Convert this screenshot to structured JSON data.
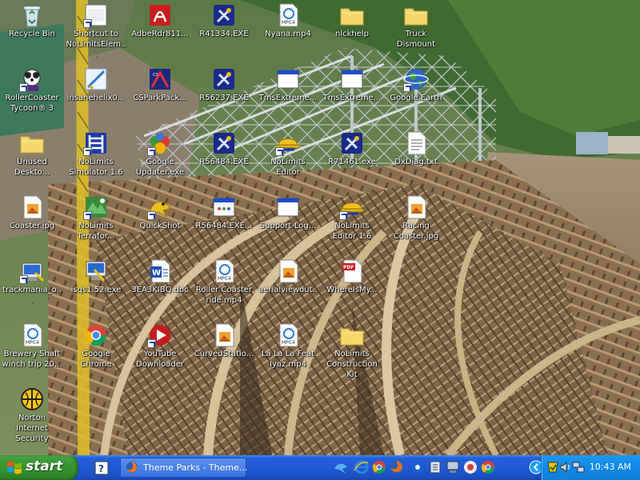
{
  "desktop": {
    "icons": [
      {
        "label": "Recycle Bin",
        "icon": "recycle-bin-icon"
      },
      {
        "label": "Shortcut to NoLimitsElem...",
        "icon": "shortcut-app-icon"
      },
      {
        "label": "AdbeRdr811...",
        "icon": "adobe-reader-installer-icon"
      },
      {
        "label": "R41334.EXE",
        "icon": "installer-exe-icon"
      },
      {
        "label": "Nyana.mp4",
        "icon": "mp4-file-icon"
      },
      {
        "label": "nlckhelp",
        "icon": "folder-icon"
      },
      {
        "label": "Truck Dismount",
        "icon": "folder-icon"
      },
      {
        "label": "RollerCoaster Tycoon® 3",
        "icon": "rollercoaster-tycoon-icon"
      },
      {
        "label": "insanehelix0...",
        "icon": "image-file-icon"
      },
      {
        "label": "CSParkPack...",
        "icon": "csparkpack-icon"
      },
      {
        "label": "R56237.EXE",
        "icon": "installer-exe-icon"
      },
      {
        "label": "TmsExtreme...",
        "icon": "window-app-icon"
      },
      {
        "label": "TmsExtreme...",
        "icon": "window-app-icon"
      },
      {
        "label": "Google Earth",
        "icon": "google-earth-icon"
      },
      {
        "label": "Unused Deskto...",
        "icon": "folder-icon"
      },
      {
        "label": "NoLimits Simulator 1.6",
        "icon": "nolimits-simulator-icon"
      },
      {
        "label": "Google Updater.exe",
        "icon": "google-updater-icon"
      },
      {
        "label": "R56484.EXE",
        "icon": "installer-exe-icon"
      },
      {
        "label": "NoLimits Editor",
        "icon": "nolimits-editor-icon"
      },
      {
        "label": "R71461.exe",
        "icon": "installer-exe-icon"
      },
      {
        "label": "DxDiag.txt",
        "icon": "text-file-icon"
      },
      {
        "label": "Coaster.jpg",
        "icon": "jpg-file-icon"
      },
      {
        "label": "NoLimits Terrafor...",
        "icon": "nolimits-terraformer-icon"
      },
      {
        "label": "QuickShot",
        "icon": "quickshot-icon"
      },
      {
        "label": "R56484.EXE...",
        "icon": "exe-window-icon"
      },
      {
        "label": "Support-Log...",
        "icon": "window-app-icon"
      },
      {
        "label": "NoLimits Editor 1.6",
        "icon": "nolimits-editor-icon"
      },
      {
        "label": "Racing Coaster.jpg",
        "icon": "jpg-file-icon"
      },
      {
        "label": "trackmania_o...",
        "icon": "exe-setup-icon"
      },
      {
        "label": "isqs1.52.exe",
        "icon": "exe-setup-icon"
      },
      {
        "label": "3EA3KIBQ.doc",
        "icon": "word-doc-icon"
      },
      {
        "label": "Roller Coaster ride.mp4",
        "icon": "mp4-file-icon"
      },
      {
        "label": "aerialviewout...",
        "icon": "jpg-file-icon"
      },
      {
        "label": "WhereIsMy...",
        "icon": "pdf-file-icon"
      },
      {
        "label": "Brewery Shaft winch trip 20...",
        "icon": "mp4-file-icon"
      },
      {
        "label": "Google Chrome",
        "icon": "chrome-icon"
      },
      {
        "label": "YouTube Downloader",
        "icon": "youtube-downloader-icon"
      },
      {
        "label": "CurvedStatio...",
        "icon": "jpg-file-icon"
      },
      {
        "label": "La La La Feat Iyaz.mp4",
        "icon": "mp4-file-icon"
      },
      {
        "label": "NoLimits Construction Kit",
        "icon": "folder-icon"
      },
      {
        "label": "Norton Internet Security",
        "icon": "norton-icon"
      }
    ]
  },
  "taskbar": {
    "start_label": "start",
    "quicklaunch": [
      {
        "icon": "help-icon"
      }
    ],
    "task_buttons": [
      {
        "label": "Theme Parks - Theme...",
        "icon": "firefox-icon"
      }
    ],
    "midtray_icons": [
      "bird-icon",
      "ie-icon",
      "chrome-icon",
      "firefox-icon",
      "messenger-icon",
      "network-icon",
      "computer-icon",
      "media-icon",
      "chrome-icon"
    ],
    "tray_icons": [
      "chevron-left-icon",
      "norton-tray-icon",
      "volume-icon",
      "network-tray-icon"
    ],
    "clock": "10:43 AM"
  },
  "colors": {
    "taskbar": "#245edb",
    "start": "#3c9a37",
    "tray": "#128ae8"
  }
}
